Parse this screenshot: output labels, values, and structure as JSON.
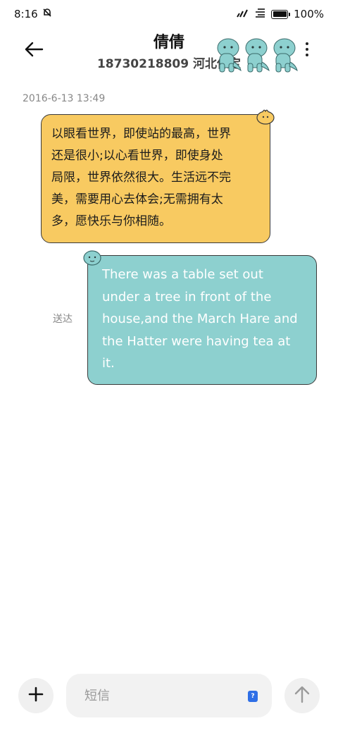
{
  "status_bar": {
    "time": "8:16",
    "battery_text": "100%",
    "battery_level": 1.0,
    "icons": [
      "do-not-disturb-icon",
      "signal-icon",
      "wifi-icon",
      "battery-icon"
    ]
  },
  "header": {
    "contact_name": "倩倩",
    "contact_detail": "18730218809 河北保定",
    "icons": [
      "back-arrow-icon",
      "dino-mascot-icon",
      "more-options-icon"
    ]
  },
  "conversation": {
    "timestamp": "2016-6-13 13:49",
    "incoming": {
      "lines": [
        "以眼看世界，即使站的最高，世界",
        "还是很小;以心看世界，即使身处",
        "局限，世界依然很大。生活远不完",
        "美，需要用心去体会;无需拥有太",
        "多，愿快乐与你相随。"
      ]
    },
    "outgoing": {
      "lines": [
        "There was a table set out",
        "under a tree in front of the",
        "house,and the March Hare and",
        "the Hatter were having tea at",
        "it."
      ],
      "status": "送达"
    }
  },
  "composer": {
    "placeholder": "短信",
    "value": "",
    "sim_label": "?",
    "icons": [
      "plus-icon",
      "sim-card-icon",
      "send-arrow-icon"
    ]
  },
  "colors": {
    "incoming_bubble": "#f8ca61",
    "outgoing_bubble": "#8dd0cf",
    "bubble_border": "#3a3a3a",
    "mascot": "#8dd0cf"
  }
}
